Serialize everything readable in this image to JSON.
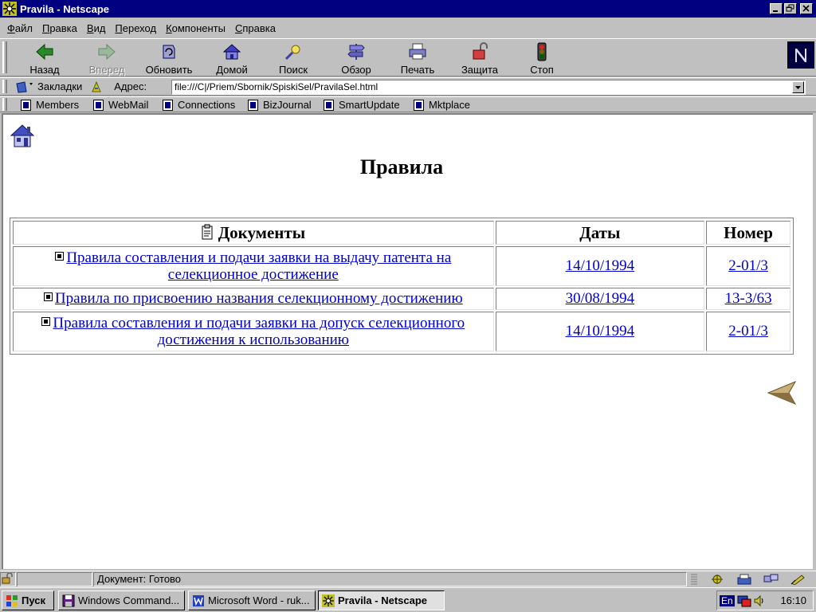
{
  "window": {
    "title": "Pravila - Netscape"
  },
  "menu": [
    "Файл",
    "Правка",
    "Вид",
    "Переход",
    "Компоненты",
    "Справка"
  ],
  "toolbar": {
    "back": "Назад",
    "forward": "Вперед",
    "reload": "Обновить",
    "home": "Домой",
    "search": "Поиск",
    "guide": "Обзор",
    "print": "Печать",
    "security": "Защита",
    "stop": "Стоп"
  },
  "location": {
    "bookmarks_label": "Закладки",
    "address_label": "Адрес:",
    "url": "file:///C|/Priem/Sbornik/SpiskiSel/PravilaSel.html"
  },
  "personal_toolbar": [
    "Members",
    "WebMail",
    "Connections",
    "BizJournal",
    "SmartUpdate",
    "Mktplace"
  ],
  "page": {
    "heading": "Правила",
    "table": {
      "headers": {
        "documents": "Документы",
        "dates": "Даты",
        "number": "Номер"
      },
      "rows": [
        {
          "title": "Правила составления и подачи заявки на выдачу патента на селекционное достижение ",
          "date": "14/10/1994",
          "number": "2-01/3"
        },
        {
          "title": "Правила по присвоению названия селекционному достижению ",
          "date": "30/08/1994",
          "number": "13-3/63"
        },
        {
          "title": "Правила составления и подачи заявки на допуск селекционного достижения к использованию ",
          "date": "14/10/1994",
          "number": "2-01/3"
        }
      ]
    }
  },
  "status": {
    "text": "Документ: Готово"
  },
  "taskbar": {
    "start": "Пуск",
    "tasks": [
      "Windows Command...",
      "Microsoft Word - ruk...",
      "Pravila - Netscape"
    ],
    "lang": "En",
    "clock": "16:10"
  },
  "colors": {
    "title_bar": "#000080",
    "link": "#0000cc",
    "chrome": "#c0c0c0"
  }
}
